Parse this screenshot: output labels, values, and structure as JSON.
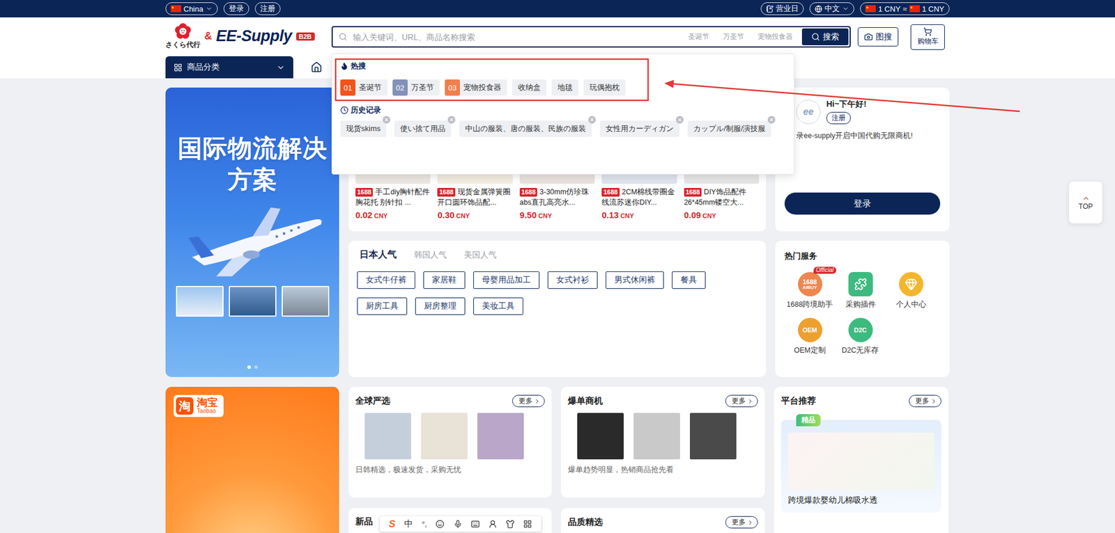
{
  "topbar": {
    "region": "China",
    "auth": [
      "登录",
      "注册"
    ],
    "business_day": "营业日",
    "language": "中文",
    "currency": {
      "from": "1 CNY",
      "approx": "≈",
      "to": "1 CNY"
    }
  },
  "logo": {
    "sakura": "さくら代行",
    "amp": "&",
    "brand": "EE-Supply",
    "badge": "B2B"
  },
  "search": {
    "placeholder": "输入关键词、URL、商品名称搜索",
    "hot_words": [
      "圣诞节",
      "万圣节",
      "宠物投食器"
    ],
    "button": "搜索"
  },
  "image_search": "图搜",
  "cart": "购物车",
  "nav": {
    "category_button": "商品分类"
  },
  "dropdown": {
    "hot_title": "热搜",
    "hot": [
      {
        "kind": "ranked",
        "rank": "01",
        "label": "圣诞节",
        "color": "#f2541b"
      },
      {
        "kind": "ranked",
        "rank": "02",
        "label": "万圣节",
        "color": "#8391b8"
      },
      {
        "kind": "ranked",
        "rank": "03",
        "label": "宠物投食器",
        "color": "#f07f4c"
      },
      {
        "kind": "plain",
        "rank": "",
        "label": "收纳盒",
        "color": ""
      },
      {
        "kind": "plain",
        "rank": "",
        "label": "地毯",
        "color": ""
      },
      {
        "kind": "plain",
        "rank": "",
        "label": "玩偶抱枕",
        "color": ""
      }
    ],
    "history_title": "历史记录",
    "history": [
      "现货skims",
      "使い捨て用品",
      "中山の服装、唐の服装、民族の服装",
      "女性用カーディガン",
      "カップル/制服/演技服"
    ]
  },
  "logistics_banner": {
    "title_lines": [
      "国际物流解决",
      "方案"
    ],
    "dots": [
      {
        "selected": true
      },
      {
        "selected": false
      }
    ]
  },
  "products": [
    {
      "source": "1688",
      "title": "手工diy胸针配件胸花托 别针扣 ...",
      "price": "0.02",
      "unit": "CNY"
    },
    {
      "source": "1688",
      "title": "现货金属弹簧圈开口圆环饰品配...",
      "price": "0.30",
      "unit": "CNY"
    },
    {
      "source": "1688",
      "title": "3-30mm仿珍珠abs直孔高亮水...",
      "price": "9.50",
      "unit": "CNY"
    },
    {
      "source": "1688",
      "title": "2CM棉线带圈金线流苏迷你DIY...",
      "price": "0.13",
      "unit": "CNY"
    },
    {
      "source": "1688",
      "title": "DIY饰品配件26*45mm镂空大...",
      "price": "0.09",
      "unit": "CNY"
    }
  ],
  "popular": {
    "tabs": [
      {
        "label": "日本人气",
        "selected": true
      },
      {
        "label": "韩国人气",
        "selected": false
      },
      {
        "label": "美国人气",
        "selected": false
      }
    ],
    "tags": [
      "女式牛仔裤",
      "家居鞋",
      "母婴用品加工",
      "女式衬衫",
      "男式休闲裤",
      "餐具",
      "厨房工具",
      "厨房整理",
      "美妆工具"
    ]
  },
  "user_card": {
    "avatar": "ee",
    "greeting": "Hi~下午好!",
    "register": "注册",
    "message": "录ee-supply开启中国代购无限商机!",
    "login": "登录"
  },
  "services": {
    "title": "热门服务",
    "items": [
      {
        "kind": "text",
        "label": "1688跨境助手",
        "icon_text": [
          "1688",
          "AiBUY"
        ],
        "badge": "Official",
        "color": "#ef8650"
      },
      {
        "kind": "plugin",
        "label": "采购插件",
        "icon_text": [],
        "badge": "",
        "color": "#3dbb7e"
      },
      {
        "kind": "diamond",
        "label": "个人中心",
        "icon_text": [],
        "badge": "",
        "color": "#f4b62c"
      },
      {
        "kind": "text",
        "label": "OEM定制",
        "icon_text": [
          "OEM"
        ],
        "badge": "",
        "color": "#eea02f"
      },
      {
        "kind": "text",
        "label": "D2C无库存",
        "icon_text": [
          "D2C"
        ],
        "badge": "",
        "color": "#3dbb7e"
      }
    ]
  },
  "taobao": {
    "logo_char": "淘",
    "title": "淘宝",
    "subtitle": "Taobao"
  },
  "sections": [
    {
      "title": "全球严选",
      "more": "更多",
      "subtitle": "日韩精选，极速发货，采购无忧"
    },
    {
      "title": "爆单商机",
      "more": "更多",
      "subtitle": "爆单趋势明显，热销商品抢先看"
    }
  ],
  "platform": {
    "title": "平台推荐",
    "more": "更多",
    "tag": "精品",
    "product": "跨境爆款婴幼儿棉吸水透"
  },
  "lower_sections": [
    {
      "title": "新品",
      "more": ""
    },
    {
      "title": "品质精选",
      "more": "更多"
    }
  ],
  "top_button": "TOP",
  "ime_toolbar": {
    "logo": "S",
    "mode": "中",
    "punct": "°,"
  }
}
